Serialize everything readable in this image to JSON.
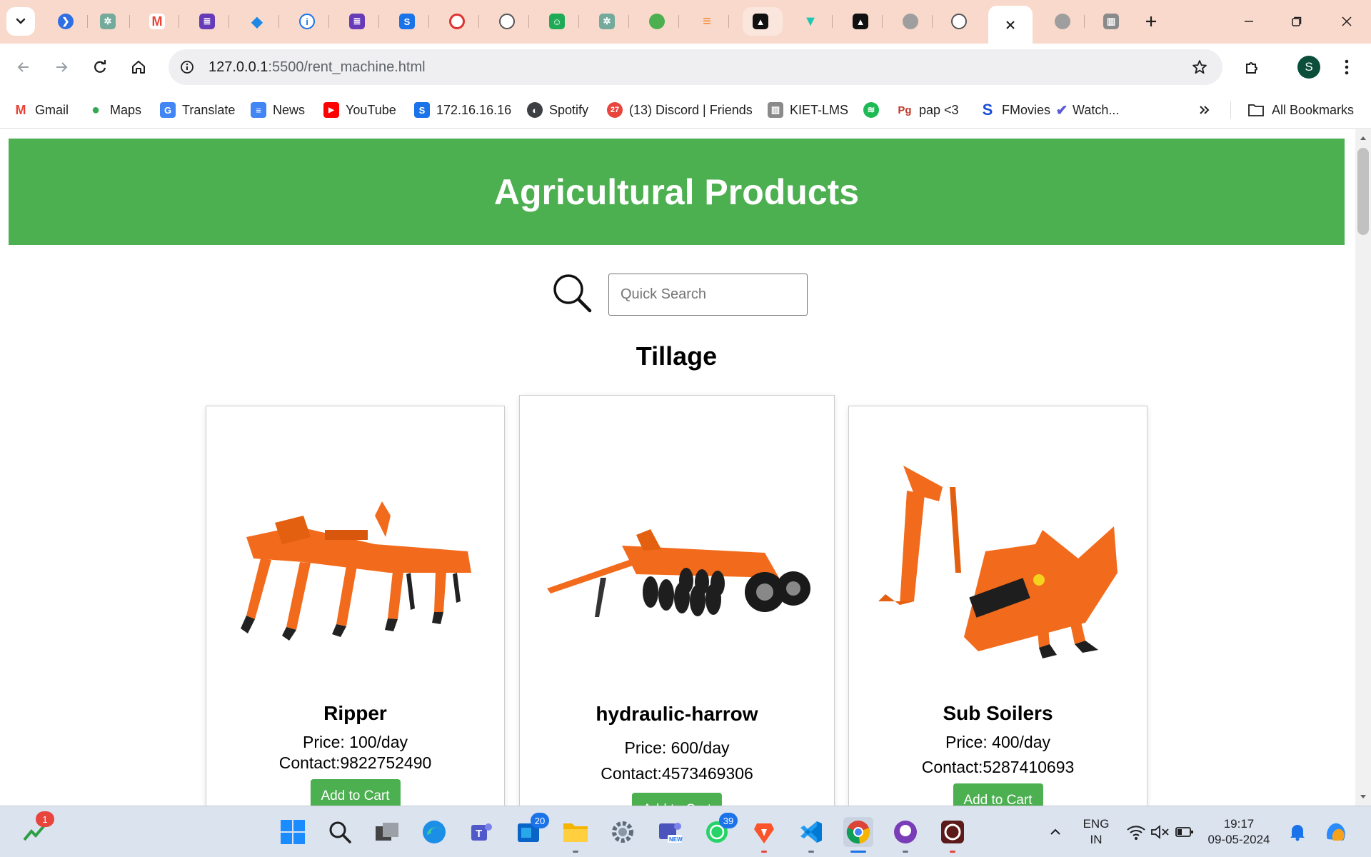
{
  "browser": {
    "tabs": [
      {
        "icon": "chevron-down-icon",
        "label": ""
      },
      {
        "icon": "site-favicon-blue-icon",
        "label": "|"
      },
      {
        "icon": "chatgpt-icon",
        "label": "("
      },
      {
        "icon": "gmail-icon",
        "label": "●"
      },
      {
        "icon": "form-icon",
        "label": "●"
      },
      {
        "icon": "diamond-icon",
        "label": ":"
      },
      {
        "icon": "info-icon",
        "label": ""
      },
      {
        "icon": "form-icon",
        "label": ":"
      },
      {
        "icon": "s-logo-icon",
        "label": "'"
      },
      {
        "icon": "target-icon",
        "label": "●"
      },
      {
        "icon": "github-icon",
        "label": ""
      },
      {
        "icon": "android-icon",
        "label": ""
      },
      {
        "icon": "chatgpt-icon",
        "label": ""
      },
      {
        "icon": "green-circle-icon",
        "label": ""
      },
      {
        "icon": "stackoverflow-icon",
        "label": ""
      },
      {
        "icon": "arc-icon",
        "label": ""
      },
      {
        "icon": "vuetify-icon",
        "label": ""
      },
      {
        "icon": "arc-icon",
        "label": ""
      },
      {
        "icon": "globe-icon",
        "label": ""
      },
      {
        "icon": "github-icon",
        "label": ""
      },
      {
        "icon": "globe-icon",
        "label": ""
      },
      {
        "icon": "kiet-icon",
        "label": ""
      }
    ],
    "url_host": "127.0.0.1",
    "url_path": ":5500/rent_machine.html",
    "profile_initial": "S",
    "bookmarks": [
      {
        "label": "Gmail",
        "icon": "gmail-icon",
        "color": "#ea4335"
      },
      {
        "label": "Maps",
        "icon": "maps-icon",
        "color": "#34a853"
      },
      {
        "label": "Translate",
        "icon": "translate-icon",
        "color": "#4285f4"
      },
      {
        "label": "News",
        "icon": "news-icon",
        "color": "#4285f4"
      },
      {
        "label": "YouTube",
        "icon": "youtube-icon",
        "color": "#ff0000"
      },
      {
        "label": "172.16.16.16",
        "icon": "s-logo-icon",
        "color": "#1a73e8"
      },
      {
        "label": "Spotify",
        "icon": "globe-icon",
        "color": "#3c4043"
      },
      {
        "label": "(13) Discord | Friends",
        "icon": "discord-icon",
        "color": "#5865f2",
        "badge": "27"
      },
      {
        "label": "KIET-LMS",
        "icon": "kiet-icon",
        "color": "#777777"
      },
      {
        "label": "",
        "icon": "spotify-icon",
        "color": "#1db954"
      },
      {
        "label": "pap <3",
        "icon": "pg-icon",
        "color": "#c0392b"
      },
      {
        "label": "FMovies",
        "icon": "s-logo-icon",
        "color": "#1a4fd6"
      },
      {
        "label": "Watch...",
        "icon": "check-icon",
        "color": "#5b5bd6"
      }
    ],
    "all_bookmarks_label": "All Bookmarks"
  },
  "page": {
    "header_title": "Agricultural Products",
    "search_placeholder": "Quick Search",
    "section_title": "Tillage",
    "add_to_cart_label": "Add to Cart",
    "products": [
      {
        "name": "Ripper",
        "price": "Price: 100/day",
        "contact": "Contact:9822752490"
      },
      {
        "name": "hydraulic-harrow",
        "price": "Price: 600/day",
        "contact": "Contact:4573469306"
      },
      {
        "name": "Sub Soilers",
        "price": "Price: 400/day",
        "contact": "Contact:5287410693"
      }
    ],
    "colors": {
      "header_green": "#4caf50",
      "implement_orange": "#f26a1b"
    }
  },
  "taskbar": {
    "stocks_badge": "1",
    "outlook_badge": "20",
    "whatsapp_badge": "39",
    "language_line1": "ENG",
    "language_line2": "IN",
    "time": "19:17",
    "date": "09-05-2024"
  }
}
